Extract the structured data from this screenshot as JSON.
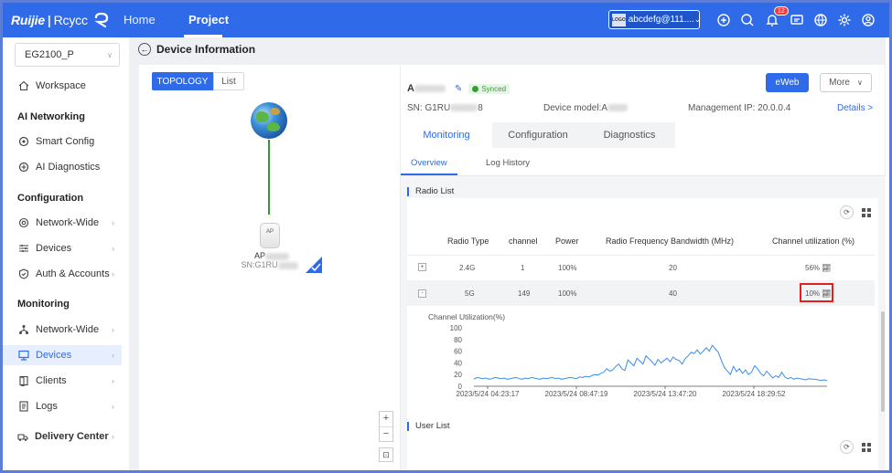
{
  "topbar": {
    "brand": "Ruijie",
    "brand_sep": "|",
    "brand2": "Rcycc",
    "nav_home": "Home",
    "nav_project": "Project",
    "account_logo": "LOGO",
    "account_name": "abcdefg@111....",
    "notification_count": "12"
  },
  "sidebar": {
    "device_select": "EG2100_P",
    "workspace": "Workspace",
    "section_ai": "AI Networking",
    "smart_config": "Smart Config",
    "ai_diagnostics": "AI Diagnostics",
    "section_config": "Configuration",
    "cfg_network_wide": "Network-Wide",
    "cfg_devices": "Devices",
    "cfg_auth": "Auth & Accounts",
    "section_monitoring": "Monitoring",
    "mon_network_wide": "Network-Wide",
    "mon_devices": "Devices",
    "mon_clients": "Clients",
    "mon_logs": "Logs",
    "delivery_center": "Delivery Center"
  },
  "page": {
    "title": "Device Information"
  },
  "topology": {
    "tab_topology": "TOPOLOGY",
    "tab_list": "List",
    "ap_icon_text": "AP",
    "ap_label_prefix": "AP",
    "ap_sn_prefix": "SN:G1RU",
    "zoom_in": "+",
    "zoom_out": "−"
  },
  "device": {
    "name_prefix": "A",
    "synced": "Synced",
    "eweb": "eWeb",
    "more": "More",
    "sn_label": "SN:  G1RU",
    "sn_suffix": "8",
    "model_label": "Device model:A",
    "mgmt_ip": "Management IP:  20.0.0.4",
    "details": "Details >"
  },
  "tabs": {
    "monitoring": "Monitoring",
    "configuration": "Configuration",
    "diagnostics": "Diagnostics",
    "overview": "Overview",
    "log_history": "Log History"
  },
  "radio_list": {
    "title": "Radio List",
    "headers": [
      "Radio Type",
      "channel",
      "Power",
      "Radio Frequency Bandwidth (MHz)",
      "Channel utilization (%)"
    ],
    "rows": [
      {
        "expand": "+",
        "type": "2.4G",
        "channel": "1",
        "power": "100%",
        "bandwidth": "20",
        "util": "56%"
      },
      {
        "expand": "-",
        "type": "5G",
        "channel": "149",
        "power": "100%",
        "bandwidth": "40",
        "util": "10%"
      }
    ]
  },
  "user_list": {
    "title": "User List"
  },
  "chart_data": {
    "type": "line",
    "title": "Channel Utilization(%)",
    "xlabel": "",
    "ylabel": "",
    "ylim": [
      0,
      100
    ],
    "yticks": [
      "100",
      "80",
      "60",
      "40",
      "20",
      "0"
    ],
    "xticks": [
      "2023/5/24 04:23:17",
      "2023/5/24 08:47:19",
      "2023/5/24 13:47:20",
      "2023/5/24 18:29:52"
    ],
    "color": "#3a8ee6",
    "series": [
      {
        "values": [
          12,
          15,
          14,
          13,
          14,
          12,
          13,
          15,
          14,
          13,
          14,
          12,
          13,
          14,
          15,
          13,
          12,
          14,
          13,
          15,
          14,
          13,
          12,
          14,
          13,
          14,
          15,
          13,
          14,
          12,
          13,
          14,
          15,
          14,
          13,
          16,
          15,
          17,
          16,
          18,
          20,
          19,
          22,
          24,
          30,
          26,
          28,
          34,
          38,
          30,
          27,
          45,
          40,
          35,
          48,
          43,
          38,
          52,
          47,
          42,
          36,
          46,
          40,
          44,
          48,
          42,
          50,
          46,
          44,
          38,
          47,
          52,
          58,
          56,
          62,
          55,
          60,
          66,
          60,
          70,
          64,
          58,
          44,
          32,
          26,
          20,
          34,
          25,
          30,
          22,
          28,
          20,
          24,
          35,
          30,
          22,
          18,
          26,
          20,
          14,
          18,
          15,
          24,
          16,
          13,
          15,
          12,
          14,
          13,
          12,
          11,
          13,
          12,
          12,
          11,
          10,
          11,
          10
        ]
      }
    ]
  },
  "colors": {
    "primary": "#2f6ae8",
    "topbar": "#2f6ae8",
    "synced": "#3a9d3a",
    "highlight": "#e02020"
  }
}
